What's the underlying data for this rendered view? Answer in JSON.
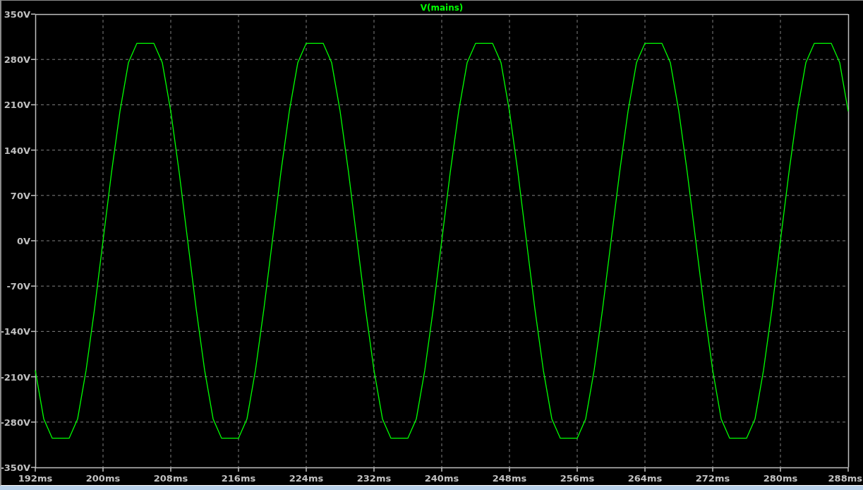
{
  "plot": {
    "chart_data": {
      "type": "line",
      "grid": true,
      "xlim": [
        192,
        288
      ],
      "ylim": [
        -350,
        350
      ],
      "xticks": [
        {
          "value": 192,
          "label": "192ms"
        },
        {
          "value": 200,
          "label": "200ms"
        },
        {
          "value": 208,
          "label": "208ms"
        },
        {
          "value": 216,
          "label": "216ms"
        },
        {
          "value": 224,
          "label": "224ms"
        },
        {
          "value": 232,
          "label": "232ms"
        },
        {
          "value": 240,
          "label": "240ms"
        },
        {
          "value": 248,
          "label": "248ms"
        },
        {
          "value": 256,
          "label": "256ms"
        },
        {
          "value": 264,
          "label": "264ms"
        },
        {
          "value": 272,
          "label": "272ms"
        },
        {
          "value": 280,
          "label": "280ms"
        },
        {
          "value": 288,
          "label": "288ms"
        }
      ],
      "yticks": [
        {
          "value": 350,
          "label": "350V"
        },
        {
          "value": 280,
          "label": "280V"
        },
        {
          "value": 210,
          "label": "210V"
        },
        {
          "value": 140,
          "label": "140V"
        },
        {
          "value": 70,
          "label": "70V"
        },
        {
          "value": 0,
          "label": "0V"
        },
        {
          "value": -70,
          "label": "-70V"
        },
        {
          "value": -140,
          "label": "-140V"
        },
        {
          "value": -210,
          "label": "-210V"
        },
        {
          "value": -280,
          "label": "-280V"
        },
        {
          "value": -350,
          "label": "-350V"
        }
      ],
      "x": [
        192,
        193,
        194,
        195,
        196,
        197,
        198,
        199,
        200,
        201,
        202,
        203,
        204,
        205,
        206,
        207,
        208,
        209,
        210,
        211,
        212,
        213,
        214,
        215,
        216,
        217,
        218,
        219,
        220,
        221,
        222,
        223,
        224,
        225,
        226,
        227,
        228,
        229,
        230,
        231,
        232,
        233,
        234,
        235,
        236,
        237,
        238,
        239,
        240,
        241,
        242,
        243,
        244,
        245,
        246,
        247,
        248,
        249,
        250,
        251,
        252,
        253,
        254,
        255,
        256,
        257,
        258,
        259,
        260,
        261,
        262,
        263,
        264,
        265,
        266,
        267,
        268,
        269,
        270,
        271,
        272,
        273,
        274,
        275,
        276,
        277,
        278,
        279,
        280,
        281,
        282,
        283,
        284,
        285,
        286,
        287,
        288
      ],
      "series": [
        {
          "name": "V(mains)",
          "color": "#00ff00",
          "values": [
            -200,
            -275,
            -305,
            -305,
            -305,
            -275,
            -200,
            -105,
            0,
            105,
            200,
            275,
            305,
            305,
            305,
            275,
            200,
            105,
            0,
            -105,
            -200,
            -275,
            -305,
            -305,
            -305,
            -275,
            -200,
            -105,
            0,
            105,
            200,
            275,
            305,
            305,
            305,
            275,
            200,
            105,
            0,
            -105,
            -200,
            -275,
            -305,
            -305,
            -305,
            -275,
            -200,
            -105,
            0,
            105,
            200,
            275,
            305,
            305,
            305,
            275,
            200,
            105,
            0,
            -105,
            -200,
            -275,
            -305,
            -305,
            -305,
            -275,
            -200,
            -105,
            0,
            105,
            200,
            275,
            305,
            305,
            305,
            275,
            200,
            105,
            0,
            -105,
            -200,
            -275,
            -305,
            -305,
            -305,
            -275,
            -200,
            -105,
            0,
            105,
            200,
            275,
            305,
            305,
            305,
            275,
            200
          ]
        }
      ]
    }
  }
}
